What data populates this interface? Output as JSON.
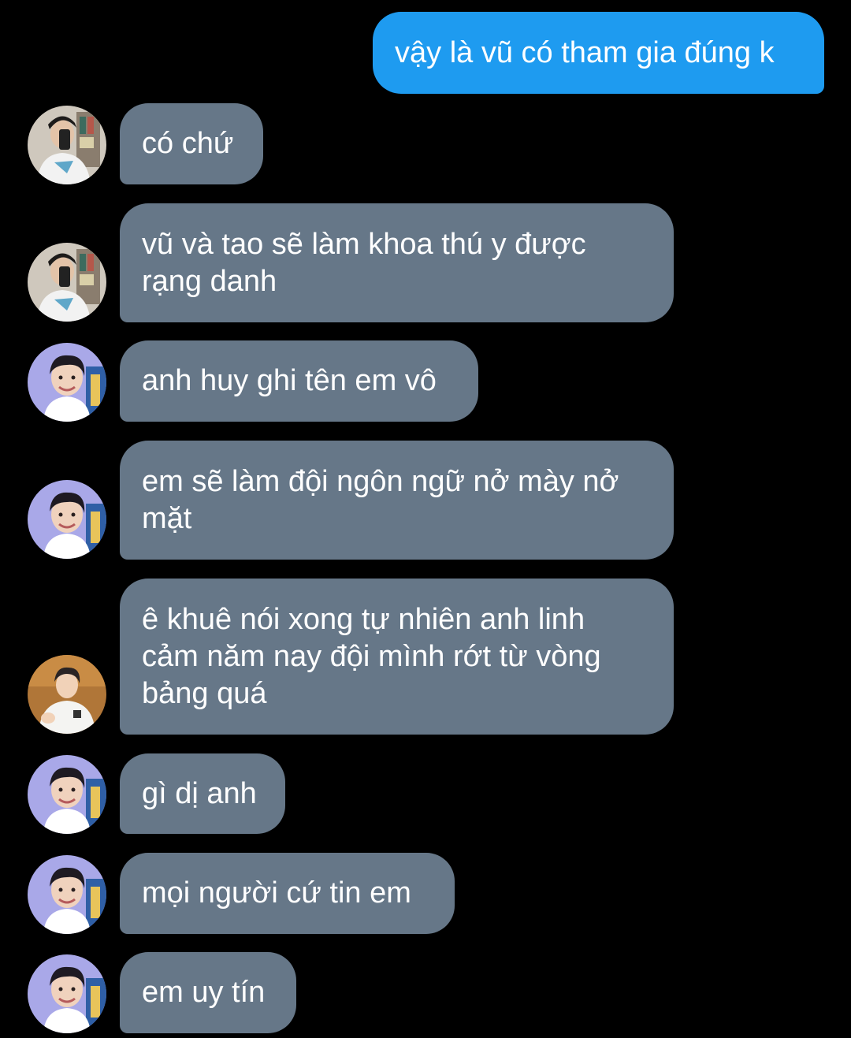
{
  "colors": {
    "background": "#000000",
    "sent_bubble": "#1e9bf0",
    "received_bubble": "#667788",
    "text": "#ffffff"
  },
  "messages": [
    {
      "direction": "sent",
      "text": "vậy là vũ có tham gia đúng k"
    },
    {
      "direction": "received",
      "sender_avatar": "avatar-boy-mirror-selfie",
      "text": "có chứ"
    },
    {
      "direction": "received",
      "sender_avatar": "avatar-boy-mirror-selfie",
      "lines": [
        "vũ và tao sẽ làm khoa thú y được",
        "rạng danh"
      ]
    },
    {
      "direction": "received",
      "sender_avatar": "avatar-boy-smiling",
      "text": "anh huy ghi tên em vô"
    },
    {
      "direction": "received",
      "sender_avatar": "avatar-boy-smiling",
      "lines": [
        "em sẽ làm đội ngôn ngữ nở mày nở",
        "mặt"
      ]
    },
    {
      "direction": "received",
      "sender_avatar": "avatar-boy-white-shirt",
      "lines": [
        "ê khuê nói xong tự nhiên anh linh",
        "cảm năm nay đội mình rớt từ vòng",
        "bảng quá"
      ]
    },
    {
      "direction": "received",
      "sender_avatar": "avatar-boy-smiling",
      "text": "gì dị anh"
    },
    {
      "direction": "received",
      "sender_avatar": "avatar-boy-smiling",
      "text": "mọi người cứ tin em"
    },
    {
      "direction": "received",
      "sender_avatar": "avatar-boy-smiling",
      "text": "em uy tín"
    }
  ]
}
